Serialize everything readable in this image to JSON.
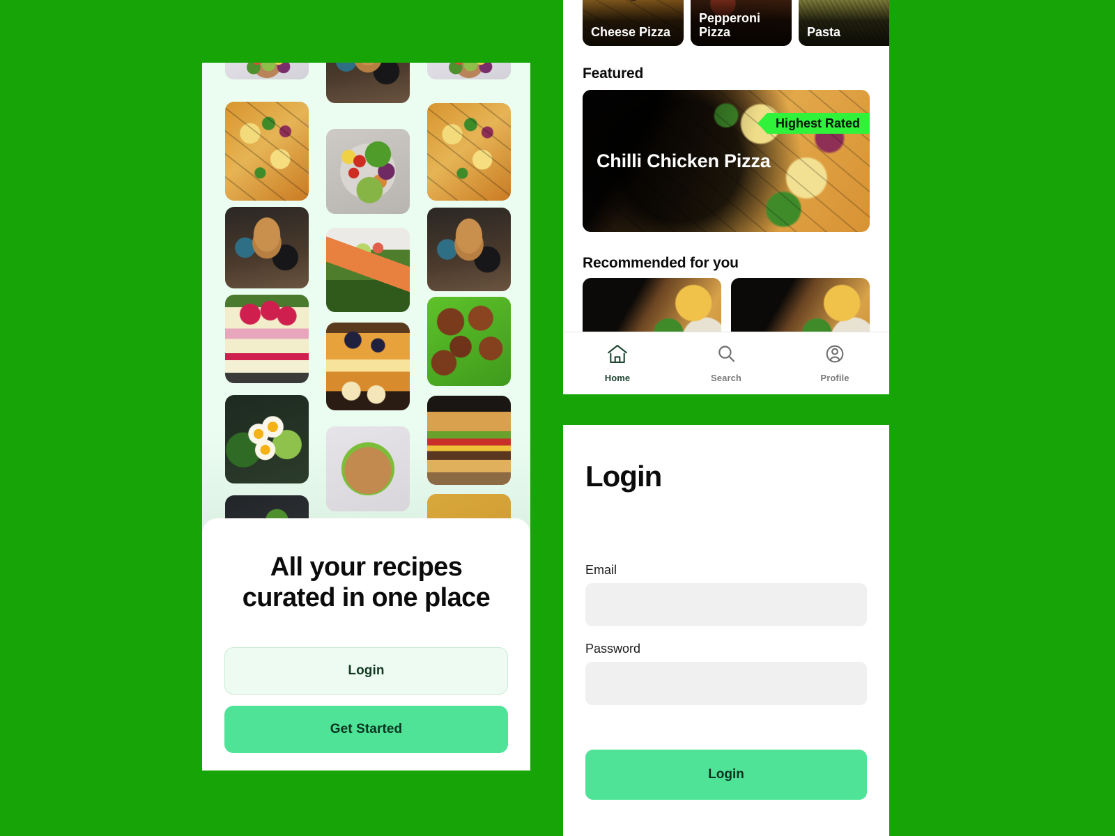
{
  "theme": {
    "page_background": "#17A406",
    "accent_green": "#4FE398",
    "badge_green": "#31F23A",
    "grid_background": "#EBFDF0",
    "soft_mint": "#EDFBF2",
    "input_grey": "#F0F0F0"
  },
  "onboarding": {
    "title": "All your recipes curated in one place",
    "login_label": "Login",
    "get_started_label": "Get Started",
    "grid": {
      "column1": [
        "salad-bowl",
        "chilli-chicken-pizza",
        "blueberry-pancakes",
        "raspberry-cake",
        "egg-avocado-toast",
        "dark-plate-dish"
      ],
      "column2": [
        "blueberry-pancakes",
        "veggie-buddha-bowl",
        "salmon-greens",
        "french-toast-banana",
        "grain-bowl"
      ],
      "column3": [
        "salad-bowl",
        "chilli-chicken-pizza",
        "blueberry-pancakes",
        "meatballs-rocket",
        "beef-burger",
        "pink-dessert"
      ]
    }
  },
  "home": {
    "categories": [
      {
        "label": "Cheese Pizza",
        "image": "cheese-pizza"
      },
      {
        "label": "Pepperoni Pizza",
        "image": "pepperoni-pizza"
      },
      {
        "label": "Pasta",
        "image": "pasta"
      }
    ],
    "featured": {
      "section_title": "Featured",
      "card_title": "Chilli Chicken Pizza",
      "badge_label": "Highest Rated",
      "image": "chilli-chicken-pizza"
    },
    "recommended": {
      "section_title": "Recommended for you",
      "items": [
        {
          "image": "chilli-chicken-pizza"
        },
        {
          "image": "chilli-chicken-pizza"
        }
      ]
    },
    "bottom_nav": {
      "items": [
        {
          "label": "Home",
          "icon": "home-icon",
          "active": true
        },
        {
          "label": "Search",
          "icon": "search-icon",
          "active": false
        },
        {
          "label": "Profile",
          "icon": "profile-icon",
          "active": false
        }
      ]
    }
  },
  "login": {
    "heading": "Login",
    "email": {
      "label": "Email",
      "value": "",
      "placeholder": ""
    },
    "password": {
      "label": "Password",
      "value": "",
      "placeholder": ""
    },
    "submit_label": "Login"
  }
}
